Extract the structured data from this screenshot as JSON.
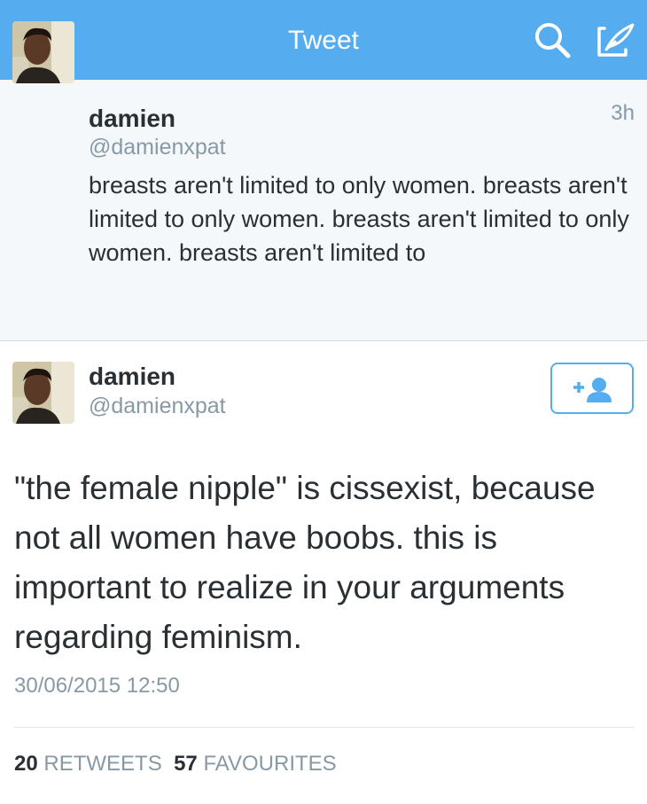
{
  "colors": {
    "nav_bar": "#55acee",
    "accent": "#55acee",
    "muted_text": "#8899a6",
    "body_text": "#292f33"
  },
  "nav": {
    "title": "Tweet",
    "back_icon": "chevron-left-icon",
    "search_icon": "search-icon",
    "compose_icon": "compose-icon"
  },
  "parent_tweet": {
    "name": "damien",
    "handle": "@damienxpat",
    "time": "3h",
    "text": "breasts aren't limited to only women. breasts aren't limited to only women. breasts aren't limited to only women. breasts aren't limited to"
  },
  "main_tweet": {
    "name": "damien",
    "handle": "@damienxpat",
    "follow_icon": "add-user-icon",
    "text": "\"the female nipple\" is cissexist, because not all women have boobs. this is important to realize in your arguments regarding feminism.",
    "date": "30/06/2015 12:50"
  },
  "stats": {
    "retweets_count": "20",
    "retweets_label": "RETWEETS",
    "favourites_count": "57",
    "favourites_label": "FAVOURITES"
  }
}
